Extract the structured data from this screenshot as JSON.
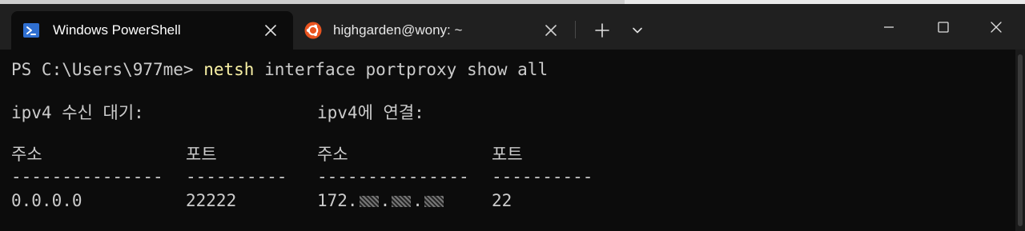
{
  "tabs": [
    {
      "title": "Windows PowerShell",
      "icon": "powershell-icon",
      "active": true
    },
    {
      "title": "highgarden@wony: ~",
      "icon": "ubuntu-icon",
      "active": false
    }
  ],
  "titlebar": {
    "new_tab": "+",
    "dropdown": "⌄"
  },
  "terminal": {
    "prompt": "PS C:\\Users\\977me> ",
    "command": "netsh",
    "args": " interface portproxy show all",
    "listen_header": "ipv4 수신 대기:",
    "connect_header": "ipv4에 연결:",
    "col_address_1": "주소",
    "col_port_1": "포트",
    "col_address_2": "주소",
    "col_port_2": "포트",
    "dash_address_1": "---------------",
    "dash_port_1": "----------",
    "dash_address_2": "---------------",
    "dash_port_2": "----------",
    "row": {
      "listen_address": "0.0.0.0",
      "listen_port": "22222",
      "connect_address_prefix": "172.",
      "connect_address_sep1": ".",
      "connect_address_sep2": ".",
      "connect_port": "22"
    }
  },
  "colors": {
    "terminal_bg": "#0c0c0c",
    "titlebar_bg": "#202020",
    "command": "#f9f1a5",
    "text": "#cccccc",
    "powershell_blue": "#2f6fd1",
    "ubuntu_orange": "#e95420"
  }
}
